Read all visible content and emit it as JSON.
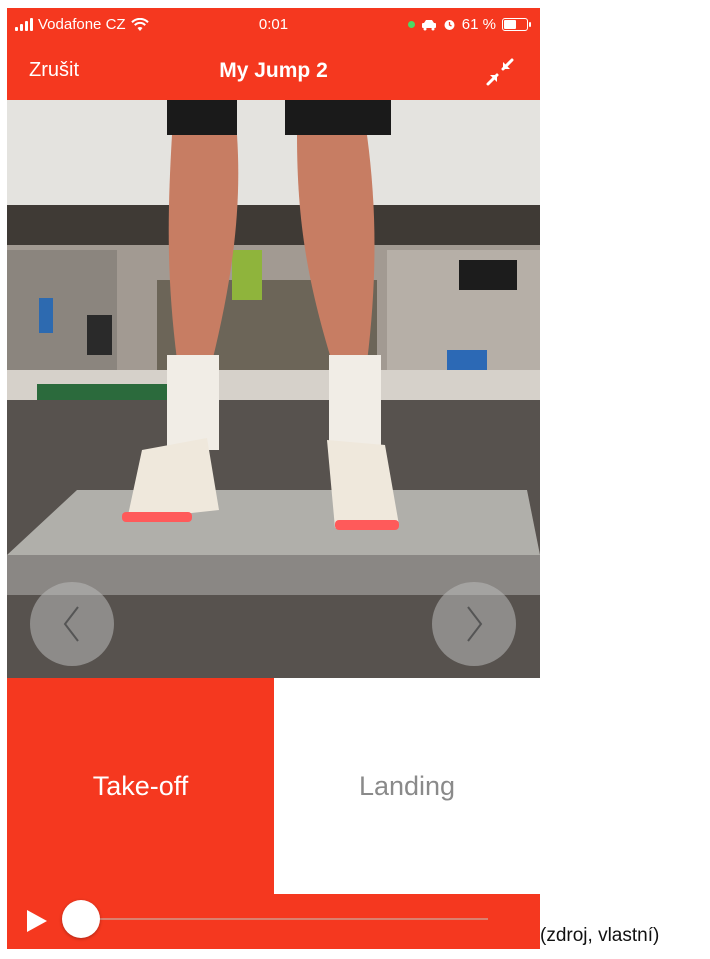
{
  "status_bar": {
    "carrier": "Vodafone CZ",
    "time": "0:01",
    "battery_percent": "61 %",
    "battery_level": 0.61
  },
  "navbar": {
    "cancel_label": "Zrušit",
    "title": "My Jump 2",
    "shrink_icon": "collapse-arrows-icon"
  },
  "video": {
    "prev_icon": "chevron-left-icon",
    "next_icon": "chevron-right-icon"
  },
  "modes": {
    "takeoff_label": "Take-off",
    "landing_label": "Landing",
    "selected": "Take-off"
  },
  "player": {
    "play_icon": "play-icon",
    "progress": 0.0
  },
  "caption": "(zdroj, vlastní)",
  "colors": {
    "accent": "#f5381f",
    "inactive_text": "#8a8a8a"
  }
}
